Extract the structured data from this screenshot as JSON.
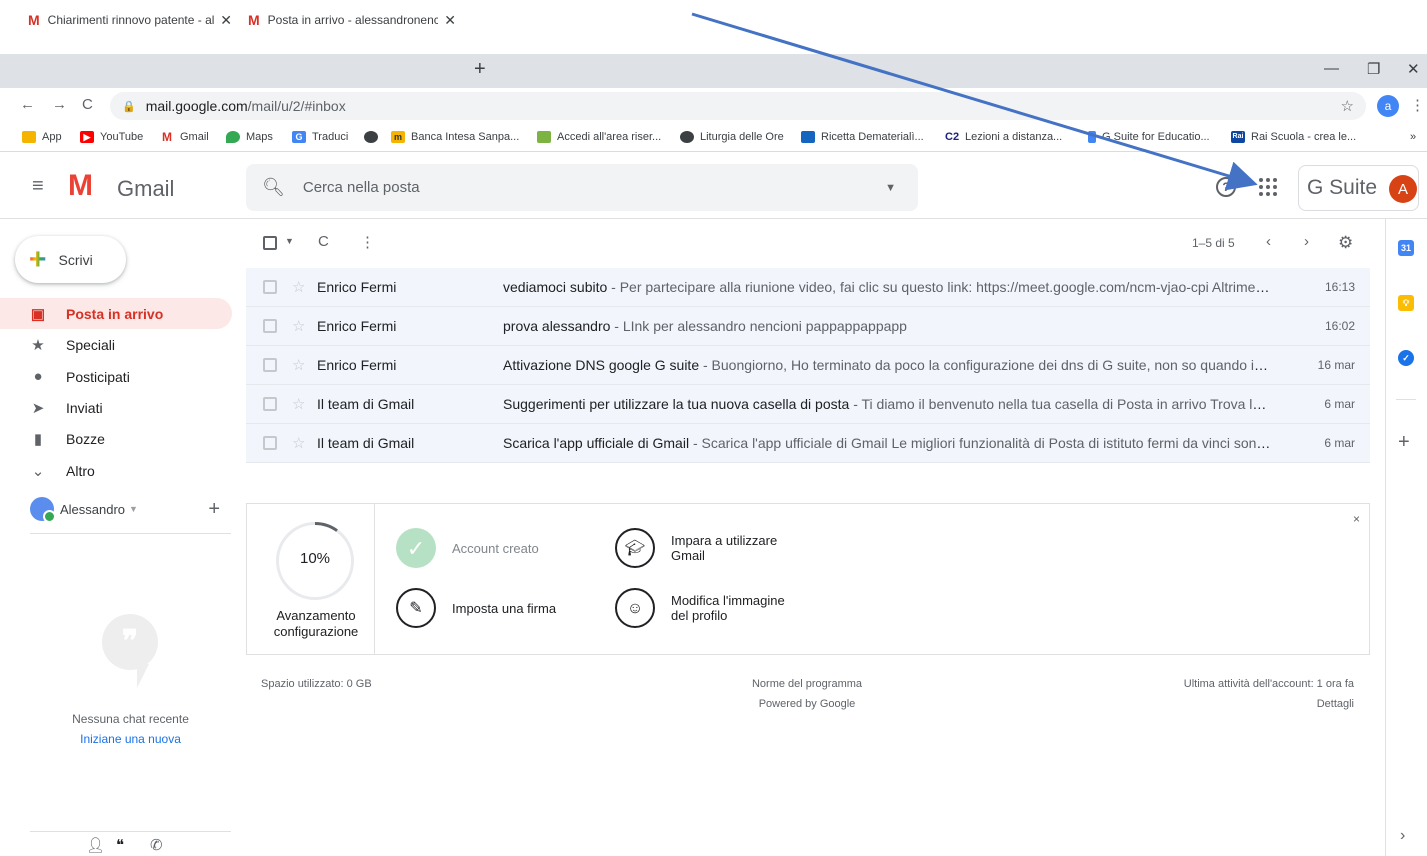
{
  "browser": {
    "tabs": [
      {
        "title": "Chiarimenti rinnovo patente - ale",
        "close": "✕"
      },
      {
        "title": "Posta in arrivo - alessandronenci",
        "close": "✕"
      }
    ],
    "new_tab": "+",
    "url_host": "mail.google.com",
    "url_path": "/mail/u/2/#inbox",
    "profile_initial": "a",
    "bookmarks": [
      "App",
      "YouTube",
      "Gmail",
      "Maps",
      "Traduci",
      "",
      "Banca Intesa Sanpa...",
      "Accedi all'area riser...",
      "Liturgia delle Ore",
      "Ricetta Dematerialì...",
      "Lezioni a distanza...",
      "G Suite for Educatio...",
      "Rai Scuola - crea le...",
      "»"
    ]
  },
  "gmail": {
    "logo_text": "Gmail",
    "search_placeholder": "Cerca nella posta",
    "gsuite_label": "G Suite",
    "avatar_initial": "A",
    "compose_label": "Scrivi",
    "nav": [
      {
        "label": "Posta in arrivo",
        "icon": "inbox-icon"
      },
      {
        "label": "Speciali",
        "icon": "star-icon"
      },
      {
        "label": "Posticipati",
        "icon": "clock-icon"
      },
      {
        "label": "Inviati",
        "icon": "send-icon"
      },
      {
        "label": "Bozze",
        "icon": "draft-icon"
      },
      {
        "label": "Altro",
        "icon": "chevron-down-icon"
      }
    ],
    "user_name": "Alessandro",
    "chat_empty": "Nessuna chat recente",
    "chat_new": "Iniziane una nuova",
    "page_count": "1–5 di 5",
    "messages": [
      {
        "from": "Enrico Fermi",
        "subject": "vediamoci subito",
        "snippet": " - Per partecipare alla riunione video, fai clic su questo link: https://meet.google.com/ncm-vjao-cpi Altrimenti, ...",
        "date": "16:13"
      },
      {
        "from": "Enrico Fermi",
        "subject": "prova alessandro",
        "snippet": " - LInk per alessandro nencioni pappappappapp",
        "date": "16:02"
      },
      {
        "from": "Enrico Fermi",
        "subject": "Attivazione DNS google G suite",
        "snippet": " - Buongiorno, Ho terminato da poco la configurazione dei dns di G suite, non so quando iniziera...",
        "date": "16 mar"
      },
      {
        "from": "Il team di Gmail",
        "subject": "Suggerimenti per utilizzare la tua nuova casella di posta",
        "snippet": " - Ti diamo il benvenuto nella tua casella di Posta in arrivo Trova le ema...",
        "date": "6 mar"
      },
      {
        "from": "Il team di Gmail",
        "subject": "Scarica l'app ufficiale di Gmail",
        "snippet": " - Scarica l'app ufficiale di Gmail Le migliori funzionalità di Posta di istituto fermi da vinci sono di...",
        "date": "6 mar"
      }
    ],
    "setup": {
      "percent_label": "10%",
      "progress": 0.1,
      "caption_line1": "Avanzamento",
      "caption_line2": "configurazione",
      "steps": [
        {
          "line1": "Account creato",
          "line2": ""
        },
        {
          "line1": "Imposta una firma",
          "line2": ""
        },
        {
          "line1": "Impara a utilizzare",
          "line2": "Gmail"
        },
        {
          "line1": "Modifica l'immagine",
          "line2": "del profilo"
        }
      ],
      "close": "×"
    },
    "footer": {
      "storage": "Spazio utilizzato: 0 GB",
      "policy": "Norme del programma",
      "powered": "Powered by Google",
      "last_activity": "Ultima attività dell'account: 1 ora fa",
      "details": "Dettagli"
    },
    "side_panel": {
      "calendar_day": "31"
    }
  },
  "colors": {
    "arrow": "#4472c4",
    "gmail_red": "#d93025",
    "selected_bg": "#fce8e6",
    "row_bg": "#f2f6fc"
  }
}
